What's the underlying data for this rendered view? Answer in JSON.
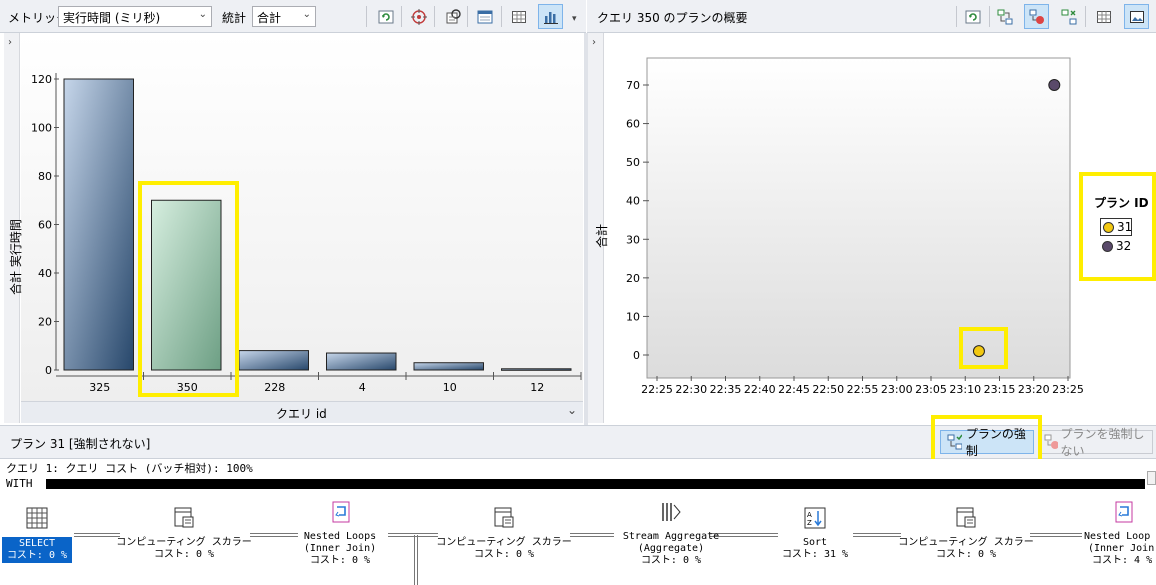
{
  "left_toolbar": {
    "metric_label": "メトリック",
    "metric_value": "実行時間 (ミリ秒)",
    "stat_label": "統計",
    "stat_value": "合計"
  },
  "right_toolbar": {
    "title": "クエリ 350 のプランの概要"
  },
  "left_chart": {
    "ylabel": "合計 実行時間",
    "xlabel": "クエリ id"
  },
  "right_chart": {
    "ylabel": "合計",
    "legend_title": "プラン ID",
    "legend_items": [
      "31",
      "32"
    ]
  },
  "chart_data": [
    {
      "type": "bar",
      "categories": [
        "325",
        "350",
        "228",
        "4",
        "10",
        "12"
      ],
      "values": [
        120,
        70,
        8,
        7,
        3,
        0.5
      ],
      "xlabel": "クエリ id",
      "ylabel": "合計 実行時間",
      "ylim": [
        0,
        120
      ],
      "yticks": [
        "120",
        "100",
        "80",
        "60",
        "40",
        "20",
        "0"
      ],
      "highlighted_category": "350",
      "colors": {
        "normal": "#2e5378",
        "highlighted": "#7aa98f"
      }
    },
    {
      "type": "scatter",
      "ylabel": "合計",
      "xticks": [
        "22:25",
        "22:30",
        "22:35",
        "22:40",
        "22:45",
        "22:50",
        "22:55",
        "23:00",
        "23:05",
        "23:10",
        "23:15",
        "23:20",
        "23:25"
      ],
      "yticks": [
        "70",
        "60",
        "50",
        "40",
        "30",
        "20",
        "10",
        "0"
      ],
      "ylim": [
        0,
        70
      ],
      "series": [
        {
          "name": "31",
          "color": "#f2c811",
          "points": [
            {
              "x": "23:12",
              "y": 1
            }
          ]
        },
        {
          "name": "32",
          "color": "#5a4a6a",
          "points": [
            {
              "x": "23:23",
              "y": 70
            }
          ]
        }
      ],
      "legend": "right"
    }
  ],
  "plan": {
    "header_title": "プラン 31 [強制されない]",
    "force_button": "プランの強制",
    "unforce_button": "プランを強制しない",
    "query_line": "クエリ 1: クエリ コスト (バッチ相対): 100%",
    "with_line": "WITH",
    "nodes": [
      {
        "name": "SELECT",
        "line2": "コスト: 0 %"
      },
      {
        "name": "コンピューティング スカラー",
        "line2": "コスト: 0 %"
      },
      {
        "name": "Nested Loops",
        "line2": "(Inner Join)",
        "line3": "コスト: 0 %"
      },
      {
        "name": "コンピューティング スカラー",
        "line2": "コスト: 0 %"
      },
      {
        "name": "Stream Aggregate",
        "line2": "(Aggregate)",
        "line3": "コスト: 0 %"
      },
      {
        "name": "Sort",
        "line2": "コスト: 31 %"
      },
      {
        "name": "コンピューティング スカラー",
        "line2": "コスト: 0 %"
      },
      {
        "name": "Nested Loop",
        "line2": "(Inner Join",
        "line3": "コスト: 4 %"
      }
    ]
  }
}
